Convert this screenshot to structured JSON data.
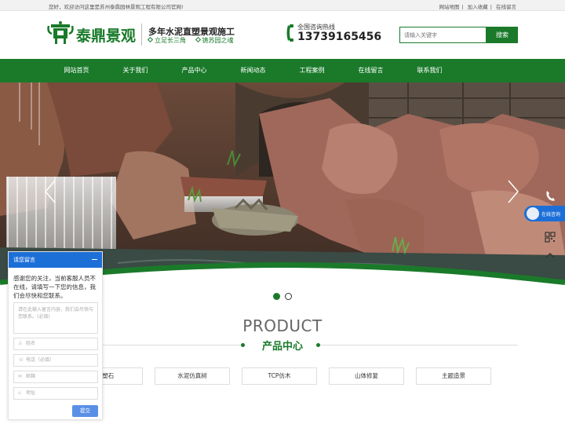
{
  "topbar": {
    "welcome": "您好，欢迎访问这里是苏州泰鼎园林景观工程有限公司官网!",
    "links": [
      "网站地图",
      "加入收藏",
      "在线留言"
    ]
  },
  "header": {
    "logo_text": "泰鼎景观",
    "slogan_main": "多年水泥直塑景观施工",
    "slogan_sub": [
      "立足长三角",
      "铸苏园之魂"
    ],
    "hotline_label": "全国咨询热线",
    "hotline_number": "13739165456",
    "search_placeholder": "请输入关键字",
    "search_button": "搜索"
  },
  "nav": {
    "items": [
      "网站首页",
      "关于我们",
      "产品中心",
      "新闻动态",
      "工程案例",
      "在线留言",
      "联系我们"
    ]
  },
  "banner": {
    "slides": 2,
    "active_slide": 1
  },
  "products": {
    "title_en": "PRODUCT",
    "title_cn": "产品中心",
    "categories": [
      "山塑石",
      "水泥仿真树",
      "TCP仿木",
      "山体修复",
      "主题造景"
    ]
  },
  "float": {
    "chat_label": "在线咨询"
  },
  "message_panel": {
    "title": "请您留言",
    "intro": "感谢您的关注，当前客服人员不在线，请填写一下您的信息，我们会尽快和您联系。",
    "textarea_placeholder": "请在此输入留言内容，我们会尽快与您联系。(必填)",
    "fields": [
      "姓名",
      "电话（必填）",
      "邮箱",
      "地址"
    ],
    "submit": "提交"
  },
  "colors": {
    "brand_green": "#1a7a2a",
    "chat_blue": "#1d6fd8"
  }
}
